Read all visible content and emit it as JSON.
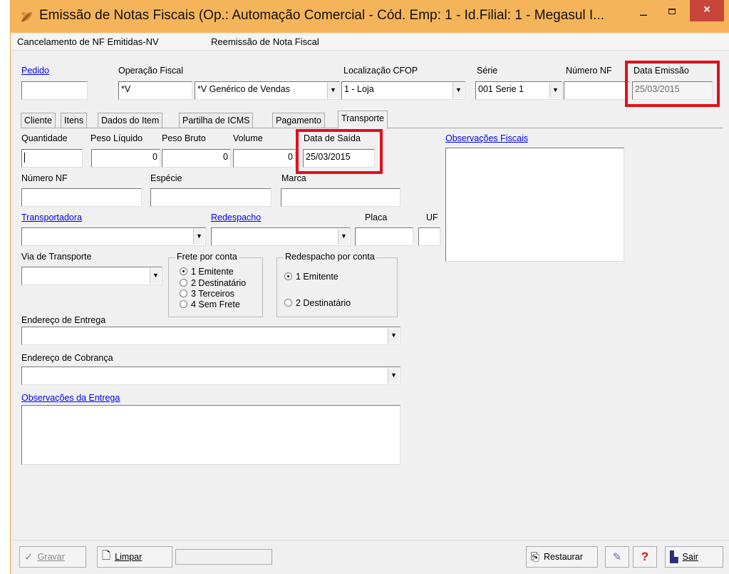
{
  "window": {
    "title": "Emissão de Notas Fiscais (Op.: Automação Comercial - Cód. Emp: 1 - Id.Filial: 1 - Megasul I...",
    "close_glyph": "×",
    "minimize_glyph": "–"
  },
  "menu": {
    "items": [
      "Cancelamento de NF Emitidas-NV",
      "Reemissão de Nota Fiscal"
    ]
  },
  "header": {
    "pedido_label": "Pedido",
    "pedido_value": "",
    "operacao_label": "Operação Fiscal",
    "operacao_code": "*V",
    "operacao_desc": "*V Genérico de Vendas",
    "cfop_label": "Localização CFOP",
    "cfop_value": "1 - Loja",
    "serie_label": "Série",
    "serie_value": "001 Serie 1",
    "numero_label": "Número NF",
    "numero_value": "",
    "data_emissao_label": "Data Emissão",
    "data_emissao_value": "25/03/2015"
  },
  "tabs": [
    "Cliente",
    "Itens",
    "Dados do Item",
    "Partilha de ICMS",
    "Pagamento",
    "Transporte"
  ],
  "transporte": {
    "quantidade_label": "Quantidade",
    "peso_liquido_label": "Peso Líquido",
    "peso_liquido_value": "0",
    "peso_bruto_label": "Peso Bruto",
    "peso_bruto_value": "0",
    "volume_label": "Volume",
    "volume_value": "0",
    "data_saida_label": "Data de Saída",
    "data_saida_value": "25/03/2015",
    "obs_fiscais_label": "Observações Fiscais",
    "numero_nf_label": "Número NF",
    "especie_label": "Espécie",
    "marca_label": "Marca",
    "transportadora_label": "Transportadora",
    "redespacho_label": "Redespacho",
    "placa_label": "Placa",
    "uf_label": "UF",
    "via_label": "Via de Transporte",
    "frete_legend": "Frete por conta",
    "frete_options": [
      "1 Emitente",
      "2 Destinatário",
      "3 Terceiros",
      "4 Sem Frete"
    ],
    "frete_selected": "1 Emitente",
    "redespacho_conta_legend": "Redespacho por conta",
    "redespacho_options": [
      "1 Emitente",
      "2 Destinatário"
    ],
    "redespacho_selected": "1 Emitente",
    "endereco_entrega_label": "Endereço de Entrega",
    "endereco_cobranca_label": "Endereço de Cobrança",
    "obs_entrega_label": "Observações da Entrega"
  },
  "buttons": {
    "gravar": "Gravar",
    "limpar": "Limpar",
    "restaurar": "Restaurar",
    "sair": "Sair",
    "help_glyph": "?"
  },
  "colors": {
    "title_bar": "#f6b45a",
    "close_button": "#c7463b",
    "highlight_box": "#e0101c",
    "link": "#0000ee"
  }
}
